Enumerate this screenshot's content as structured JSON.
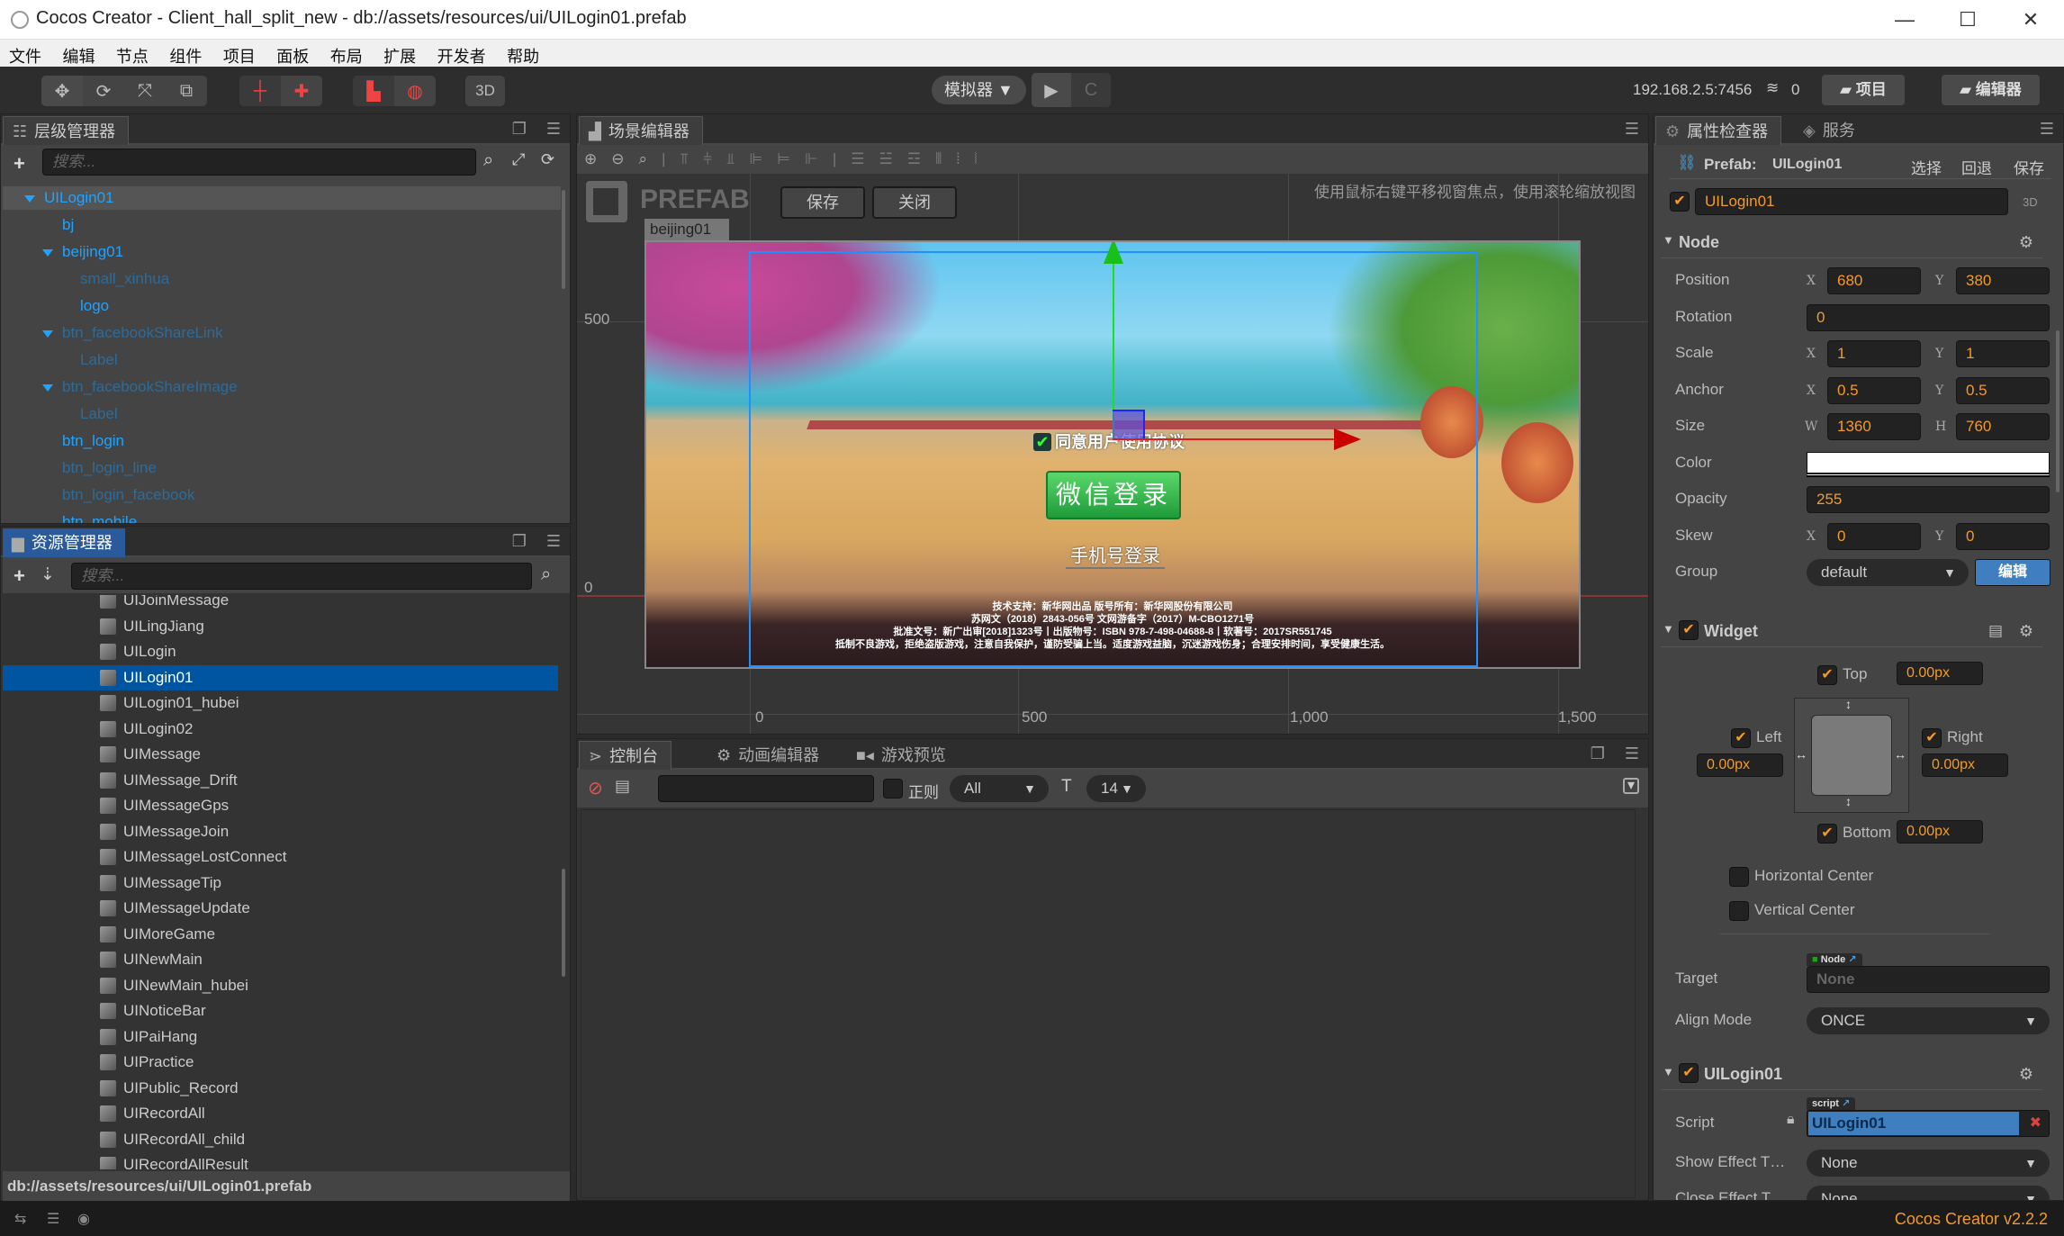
{
  "window": {
    "title": "Cocos Creator - Client_hall_split_new - db://assets/resources/ui/UILogin01.prefab",
    "controls": {
      "minimize": "—",
      "maximize": "☐",
      "close": "✕"
    }
  },
  "menu": [
    "文件",
    "编辑",
    "节点",
    "组件",
    "项目",
    "面板",
    "布局",
    "扩展",
    "开发者",
    "帮助"
  ],
  "toolbar": {
    "transform_tools": [
      "move-tool",
      "rotate-tool",
      "scale-tool",
      "rect-tool"
    ],
    "pivot_tools": [
      "pivot-local",
      "pivot-center"
    ],
    "coord_tools": [
      "local-coord",
      "global-coord"
    ],
    "mode_3d": "3D",
    "simulator": "模拟器 ▼",
    "play": "▶",
    "refresh": "C",
    "ip": "192.168.2.5:7456",
    "connections": "0",
    "project_button": "项目",
    "editor_button": "编辑器"
  },
  "hierarchy": {
    "tab": "层级管理器",
    "search_placeholder": "搜索...",
    "nodes": [
      {
        "name": "UILogin01",
        "depth": 0,
        "expanded": true,
        "active": true,
        "selected": true
      },
      {
        "name": "bj",
        "depth": 1,
        "expanded": false,
        "active": true
      },
      {
        "name": "beijing01",
        "depth": 1,
        "expanded": true,
        "active": true
      },
      {
        "name": "small_xinhua",
        "depth": 2,
        "expanded": false,
        "active": false
      },
      {
        "name": "logo",
        "depth": 2,
        "expanded": false,
        "active": true
      },
      {
        "name": "btn_facebookShareLink",
        "depth": 1,
        "expanded": true,
        "active": false
      },
      {
        "name": "Label",
        "depth": 2,
        "expanded": false,
        "active": false
      },
      {
        "name": "btn_facebookShareImage",
        "depth": 1,
        "expanded": true,
        "active": false
      },
      {
        "name": "Label",
        "depth": 2,
        "expanded": false,
        "active": false
      },
      {
        "name": "btn_login",
        "depth": 1,
        "expanded": false,
        "active": true
      },
      {
        "name": "btn_login_line",
        "depth": 1,
        "expanded": false,
        "active": false
      },
      {
        "name": "btn_login_facebook",
        "depth": 1,
        "expanded": false,
        "active": false
      },
      {
        "name": "btn_mobile",
        "depth": 1,
        "expanded": false,
        "active": true
      }
    ]
  },
  "assets": {
    "tab": "资源管理器",
    "search_placeholder": "搜索...",
    "items": [
      "UIJoinMessage",
      "UILingJiang",
      "UILogin",
      "UILogin01",
      "UILogin01_hubei",
      "UILogin02",
      "UIMessage",
      "UIMessage_Drift",
      "UIMessageGps",
      "UIMessageJoin",
      "UIMessageLostConnect",
      "UIMessageTip",
      "UIMessageUpdate",
      "UIMoreGame",
      "UINewMain",
      "UINewMain_hubei",
      "UINoticeBar",
      "UIPaiHang",
      "UIPractice",
      "UIPublic_Record",
      "UIRecordAll",
      "UIRecordAll_child",
      "UIRecordAllResult"
    ],
    "selected": "UILogin01",
    "path": "db://assets/resources/ui/UILogin01.prefab"
  },
  "scene": {
    "tab": "场景编辑器",
    "hint": "使用鼠标右键平移视窗焦点，使用滚轮缩放视图",
    "prefab_label": "PREFAB",
    "save_button": "保存",
    "close_button": "关闭",
    "node_label": "beijing01",
    "ruler_x": [
      "0",
      "500",
      "1,000",
      "1,500"
    ],
    "ruler_y": [
      "500",
      "0"
    ],
    "game": {
      "agree_text": "同意用户使用协议",
      "wechat_login": "微信登录",
      "mobile_login": "手机号登录",
      "footer": [
        "技术支持：新华网出品 版号所有：新华网股份有限公司",
        "苏网文（2018）2843-056号 文网游备字（2017）M-CBO1271号",
        "批准文号：新广出审[2018]1323号丨出版物号：ISBN 978-7-498-04688-8丨软著号：2017SR551745",
        "抵制不良游戏，拒绝盗版游戏，注意自我保护，谨防受骗上当。适度游戏益脑，沉迷游戏伤身；合理安排时间，享受健康生活。"
      ]
    }
  },
  "console": {
    "tabs": [
      "控制台",
      "动画编辑器",
      "游戏预览"
    ],
    "regex_label": "正则",
    "filter": "All",
    "font_size": "14"
  },
  "inspector": {
    "tabs": [
      "属性检查器",
      "服务"
    ],
    "prefab_label": "Prefab:",
    "prefab_name": "UILogin01",
    "actions": [
      "选择",
      "回退",
      "保存"
    ],
    "node_name": "UILogin01",
    "node_active": true,
    "mode_3d": "3D",
    "node_section": "Node",
    "position": {
      "label": "Position",
      "x": "680",
      "y": "380"
    },
    "rotation": {
      "label": "Rotation",
      "value": "0"
    },
    "scale": {
      "label": "Scale",
      "x": "1",
      "y": "1"
    },
    "anchor": {
      "label": "Anchor",
      "x": "0.5",
      "y": "0.5"
    },
    "size": {
      "label": "Size",
      "w": "1360",
      "h": "760"
    },
    "color": {
      "label": "Color",
      "value": "#ffffff"
    },
    "opacity": {
      "label": "Opacity",
      "value": "255"
    },
    "skew": {
      "label": "Skew",
      "x": "0",
      "y": "0"
    },
    "group": {
      "label": "Group",
      "value": "default",
      "edit": "编辑"
    },
    "widget": {
      "title": "Widget",
      "enabled": true,
      "top": {
        "label": "Top",
        "checked": true,
        "value": "0.00px"
      },
      "left": {
        "label": "Left",
        "checked": true,
        "value": "0.00px"
      },
      "right": {
        "label": "Right",
        "checked": true,
        "value": "0.00px"
      },
      "bottom": {
        "label": "Bottom",
        "checked": true,
        "value": "0.00px"
      },
      "hcenter": {
        "label": "Horizontal Center",
        "checked": false
      },
      "vcenter": {
        "label": "Vertical Center",
        "checked": false
      },
      "target": {
        "label": "Target",
        "type": "Node",
        "value": "None"
      },
      "align_mode": {
        "label": "Align Mode",
        "value": "ONCE"
      }
    },
    "script_component": {
      "title": "UILogin01",
      "enabled": true,
      "script": {
        "label": "Script",
        "type": "script",
        "value": "UILogin01"
      },
      "show_effect": {
        "label": "Show Effect T…",
        "value": "None"
      },
      "close_effect": {
        "label": "Close Effect T",
        "value": "None"
      }
    }
  },
  "status": {
    "version": "Cocos Creator v2.2.2"
  },
  "colors": {
    "accent_orange": "#f39a2b",
    "link_blue": "#1fa3ff",
    "selection_blue": "#0055a0"
  }
}
